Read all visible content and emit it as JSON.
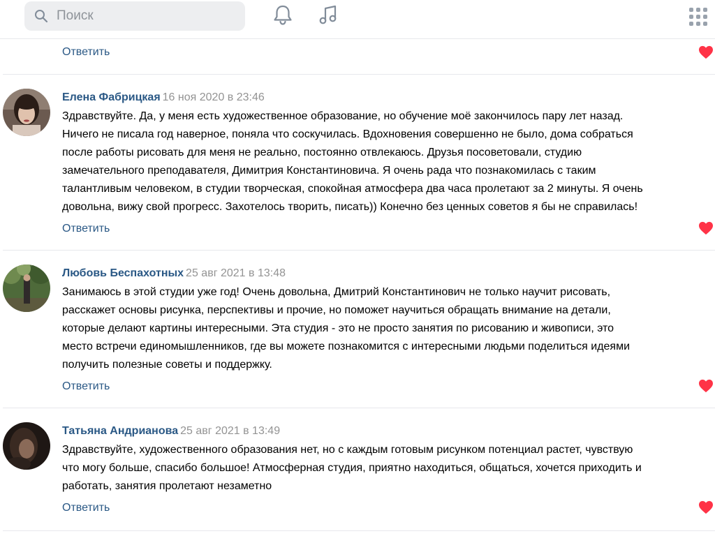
{
  "header": {
    "search": {
      "placeholder": "Поиск",
      "value": ""
    },
    "icons": [
      "search-icon",
      "bell-icon",
      "music-icon",
      "apps-grid-icon"
    ]
  },
  "colors": {
    "link": "#2a5885",
    "date": "#939393",
    "heart": "#ff3347",
    "search_bg": "#edeef0",
    "divider": "#e7e8ec"
  },
  "top_reply": {
    "reply_label": "Ответить"
  },
  "comments": [
    {
      "author": "Елена Фабрицкая",
      "date": "16 ноя 2020 в 23:46",
      "lines": [
        "Здравствуйте. Да, у меня есть художественное образование, но обучение моё закончилось пару лет назад.",
        "Ничего не писала год наверное, поняла что соскучилась. Вдохновения совершенно не было, дома собраться",
        "после работы рисовать для меня не реально, постоянно отвлекаюсь. Друзья посоветовали, студию",
        "замечательного преподавателя, Димитрия Константиновича. Я очень рада что познакомилась с таким",
        "талантливым человеком, в студии творческая, спокойная атмосфера два часа пролетают за 2 минуты. Я очень",
        "довольна, вижу свой прогресс. Захотелось творить, писать)) Конечно без ценных советов я бы не справилась!"
      ],
      "reply_label": "Ответить"
    },
    {
      "author": "Любовь Беспахотных",
      "date": "25 авг 2021 в 13:48",
      "lines": [
        "Занимаюсь в этой студии уже год! Очень довольна, Дмитрий Константинович не только научит рисовать,",
        "расскажет основы рисунка, перспективы и прочие, но поможет научиться обращать внимание на детали,",
        "которые делают картины интересными. Эта студия - это не просто занятия по рисованию и живописи, это",
        "место встречи единомышленников, где вы можете познакомится с интересными людьми поделиться идеями",
        "получить полезные советы и поддержку."
      ],
      "reply_label": "Ответить"
    },
    {
      "author": "Татьяна Андрианова",
      "date": "25 авг 2021 в 13:49",
      "lines": [
        "Здравствуйте, художественного образования нет, но с каждым готовым рисунком потенциал растет, чувствую",
        "что могу больше, спасибо большое! Атмосферная студия, приятно находиться, общаться, хочется приходить и",
        "работать, занятия пролетают незаметно"
      ],
      "reply_label": "Ответить"
    }
  ]
}
